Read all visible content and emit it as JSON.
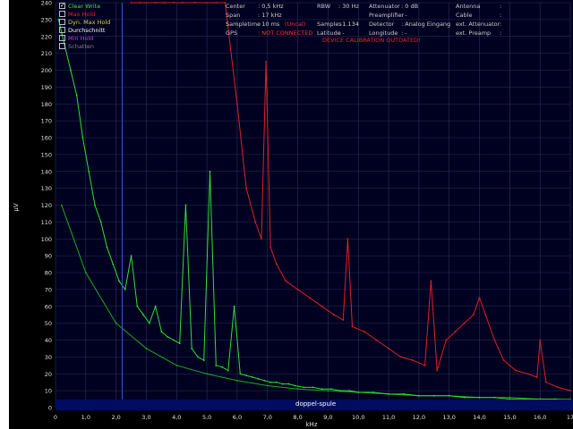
{
  "chart_data": {
    "type": "line",
    "title": "",
    "xlabel": "kHz",
    "ylabel": "µV",
    "xlim": [
      0,
      17
    ],
    "ylim": [
      0,
      240
    ],
    "x_ticks": [
      "0",
      "1,0",
      "2,0",
      "3,0",
      "4,0",
      "5,0",
      "6,0",
      "7,0",
      "8,0",
      "9,0",
      "10,0",
      "11,0",
      "12,0",
      "13,0",
      "14,0",
      "15,0",
      "16,0",
      "17"
    ],
    "y_ticks": [
      "0",
      "10",
      "20",
      "30",
      "40",
      "50",
      "60",
      "70",
      "80",
      "90",
      "100",
      "110",
      "120",
      "130",
      "140",
      "150",
      "160",
      "170",
      "180",
      "190",
      "200",
      "210",
      "220",
      "230",
      "240"
    ],
    "grid": true,
    "legend_position": "top-left",
    "series": [
      {
        "name": "Clear Write",
        "color": "#33dd33",
        "x": [
          0.1,
          0.3,
          0.5,
          0.7,
          0.9,
          1.1,
          1.3,
          1.5,
          1.7,
          1.9,
          2.1,
          2.3,
          2.5,
          2.7,
          2.9,
          3.1,
          3.3,
          3.5,
          3.7,
          3.9,
          4.1,
          4.3,
          4.5,
          4.7,
          4.9,
          5.1,
          5.3,
          5.5,
          5.7,
          5.9,
          6.1,
          6.3,
          6.5,
          6.7,
          6.9,
          7.1,
          7.3,
          7.5,
          7.7,
          7.9,
          8.2,
          8.5,
          8.8,
          9.1,
          9.4,
          9.7,
          10.0,
          10.5,
          11.0,
          11.5,
          12.0,
          12.5,
          13.0,
          13.5,
          14.0,
          14.5,
          15.0,
          15.5,
          16.0,
          16.5,
          17.0
        ],
        "y": [
          230,
          215,
          200,
          185,
          160,
          140,
          120,
          110,
          95,
          85,
          75,
          70,
          90,
          60,
          55,
          50,
          60,
          45,
          42,
          40,
          38,
          120,
          35,
          30,
          28,
          140,
          25,
          24,
          22,
          60,
          20,
          19,
          18,
          17,
          16,
          15,
          15,
          14,
          14,
          13,
          12,
          12,
          11,
          11,
          10,
          10,
          9,
          9,
          8,
          8,
          7,
          7,
          7,
          6,
          6,
          6,
          5,
          5,
          5,
          5,
          4
        ]
      },
      {
        "name": "Max Hold",
        "color": "#dd2222",
        "x": [
          2.5,
          2.8,
          3.0,
          3.3,
          3.6,
          3.9,
          4.2,
          4.6,
          5.0,
          5.3,
          5.6,
          6.0,
          6.3,
          6.6,
          6.8,
          6.95,
          7.1,
          7.3,
          7.6,
          8.0,
          8.4,
          8.8,
          9.2,
          9.5,
          9.65,
          9.8,
          10.2,
          10.6,
          11.0,
          11.4,
          11.8,
          12.2,
          12.4,
          12.6,
          12.9,
          13.2,
          13.5,
          13.8,
          14.0,
          14.2,
          14.5,
          14.8,
          15.2,
          15.6,
          15.9,
          16.0,
          16.2,
          16.6,
          17.0
        ],
        "y": [
          240,
          240,
          240,
          240,
          240,
          240,
          240,
          240,
          240,
          240,
          240,
          180,
          130,
          110,
          100,
          205,
          95,
          85,
          75,
          70,
          65,
          60,
          55,
          52,
          100,
          48,
          45,
          40,
          35,
          30,
          28,
          25,
          75,
          22,
          40,
          45,
          50,
          55,
          65,
          55,
          40,
          28,
          22,
          20,
          18,
          40,
          15,
          12,
          10
        ]
      },
      {
        "name": "Durchschnitt",
        "color": "#22aa22",
        "x": [
          0.2,
          1.0,
          2.0,
          3.0,
          4.0,
          5.0,
          6.0,
          7.0,
          8.0,
          9.0,
          10.0,
          11.0,
          12.0,
          13.0,
          14.0,
          15.0,
          16.0,
          17.0
        ],
        "y": [
          120,
          80,
          50,
          35,
          25,
          20,
          16,
          13,
          11,
          10,
          9,
          8,
          7,
          7,
          6,
          6,
          5,
          5
        ]
      }
    ],
    "annotations": [
      {
        "text": "doppel-spule"
      },
      {
        "text": "DEVICE CALIBRATION OUTDATED!"
      }
    ]
  },
  "legend": {
    "items": [
      {
        "label": "Clear Write",
        "color": "#33ee33",
        "checked": true
      },
      {
        "label": "Max Hold",
        "color": "#ee2222",
        "checked": false
      },
      {
        "label": "Dyn. Max Hold",
        "color": "#e0d040",
        "checked": false
      },
      {
        "label": "Durchschnitt",
        "color": "#ffffff",
        "checked": false
      },
      {
        "label": "Min Hold",
        "color": "#c040c0",
        "checked": false
      },
      {
        "label": "Schatten",
        "color": "#808080",
        "checked": false
      }
    ]
  },
  "info": {
    "center_label": "Center",
    "center_value": ": 0,5 kHz",
    "span_label": "Span",
    "span_value": ": 17 kHz",
    "sampletime_label": "Sampletime",
    "sampletime_value": ": 10 ms",
    "sampletime_note": "(Uncal)",
    "gps_label": "GPS",
    "gps_value": ": NOT CONNECTED",
    "rbw_label": "RBW",
    "rbw_value": ": 30 Hz",
    "samples_label": "Samples",
    "samples_value": ": 1.134",
    "latitude_label": "Latitude",
    "latitude_value": ": -",
    "attenuator_label": "Attenuator",
    "attenuator_value": ": 0 dB",
    "preamplifier_label": "Preamplifier",
    "preamplifier_value": ": -",
    "detector_label": "Detector",
    "detector_value": ": Analog Eingang",
    "longitude_label": "Longitude",
    "longitude_value": ": -",
    "antenna_label": "Antenna",
    "antenna_value": ":",
    "cable_label": "Cable",
    "cable_value": ":",
    "ext_attenuator_label": "ext. Attenuator",
    "ext_attenuator_value": ":",
    "ext_preamp_label": "ext. Preamp",
    "ext_preamp_value": ":",
    "calibration_warning": "DEVICE CALIBRATION OUTDATED!"
  },
  "marker": {
    "x": 2.2,
    "color": "#3a5fd0"
  },
  "bottom_bar": {
    "label": "doppel-spule"
  }
}
